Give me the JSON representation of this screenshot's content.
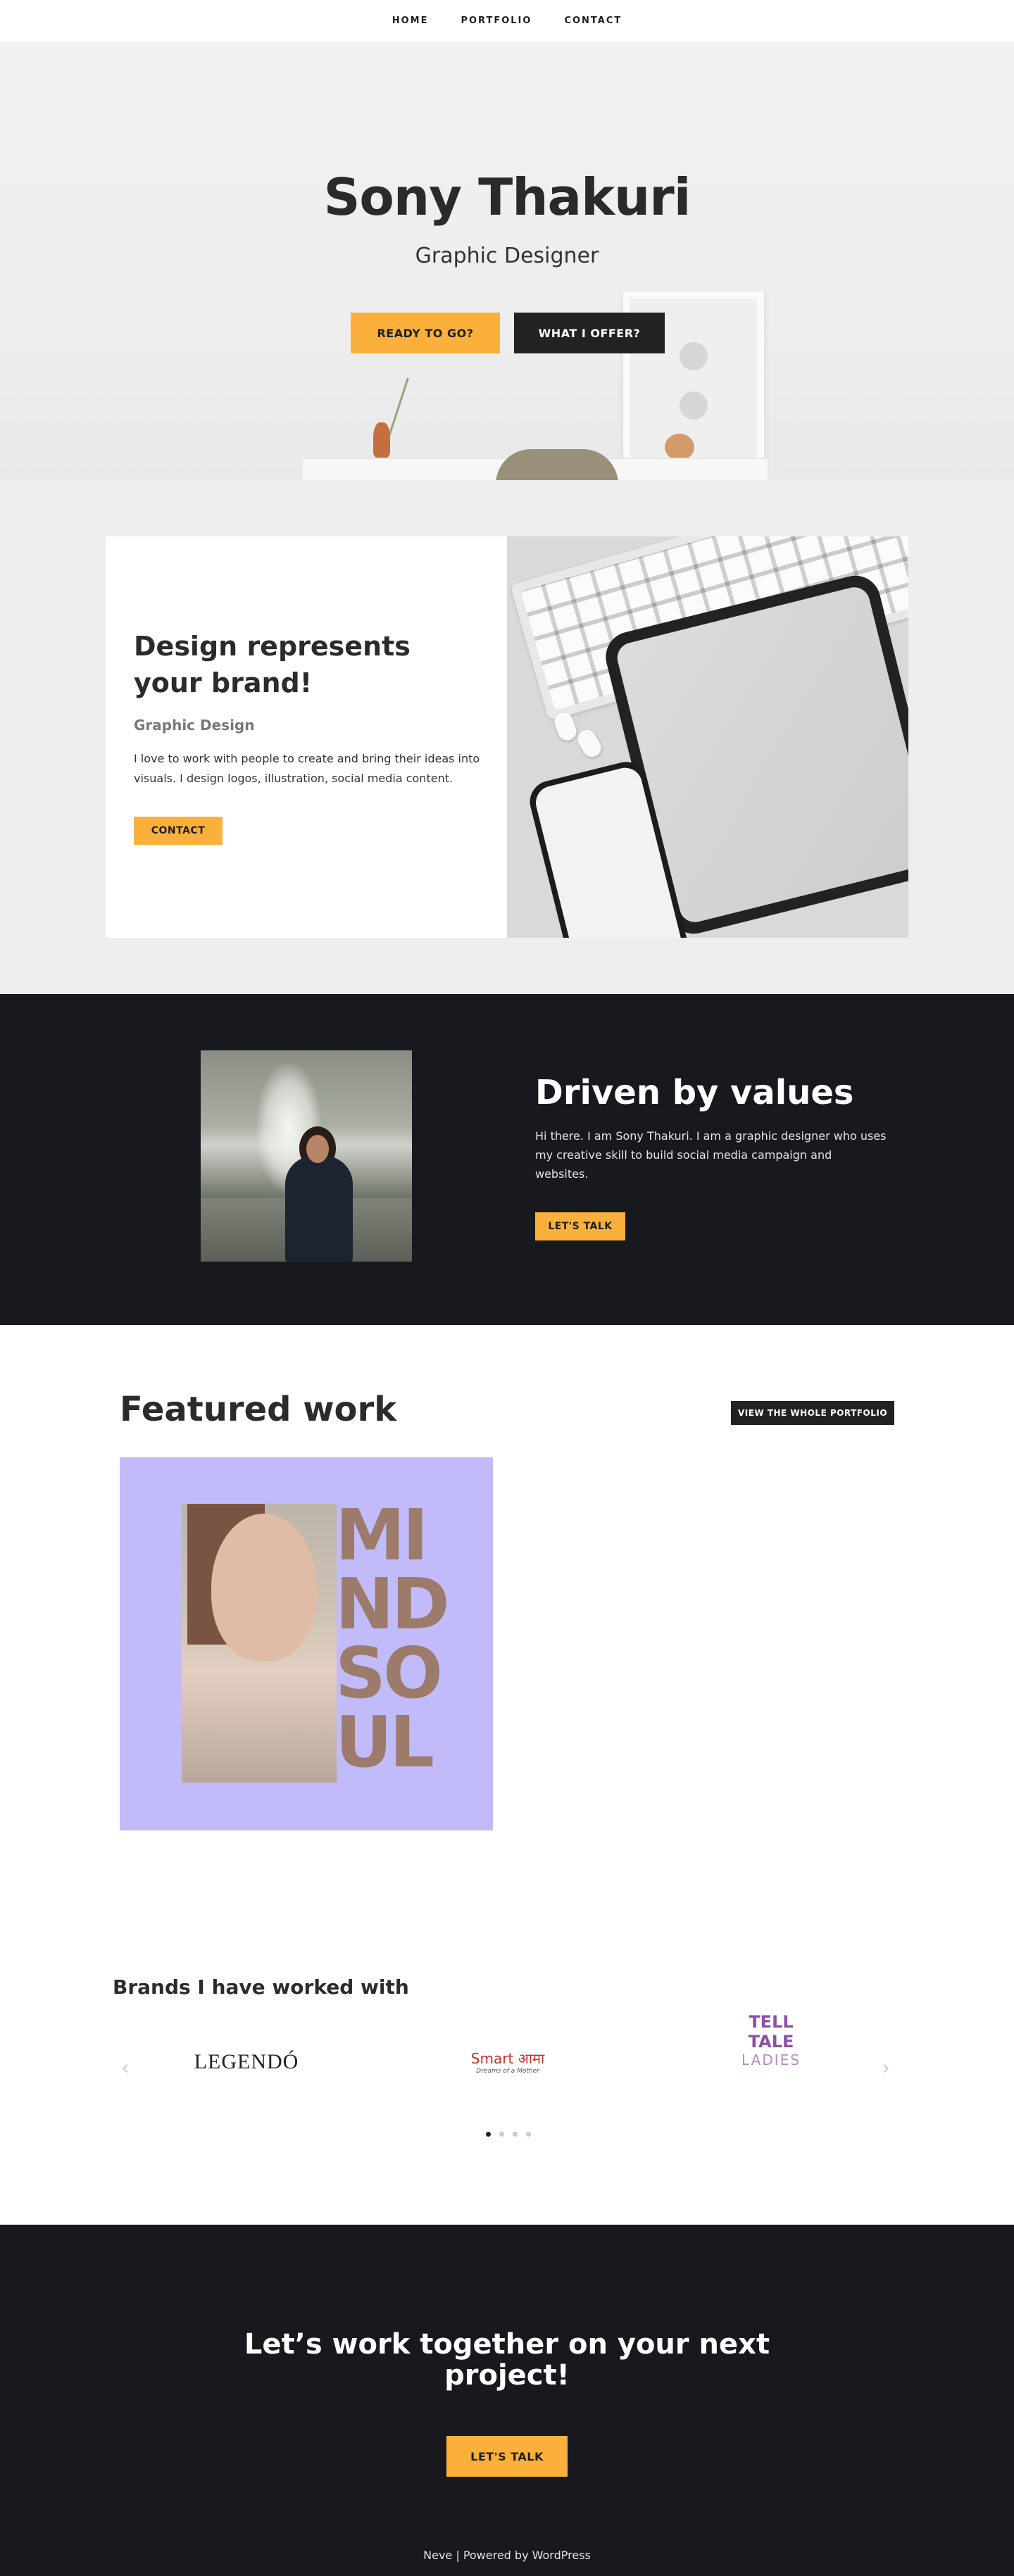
{
  "nav": {
    "items": [
      "HOME",
      "PORTFOLIO",
      "CONTACT"
    ]
  },
  "hero": {
    "title": "Sony Thakuri",
    "subtitle": "Graphic Designer",
    "btn_primary": "READY TO GO?",
    "btn_secondary": "WHAT I OFFER?"
  },
  "intro": {
    "heading": "Design represents your brand!",
    "subheading": "Graphic Design",
    "description": "I love to work with people to create and bring their ideas into visuals. I design logos, illustration, social media content.",
    "button": "CONTACT"
  },
  "about": {
    "heading": "Driven by values",
    "description": "Hi there. I am Sony Thakuri. I am a graphic designer who uses my creative skill to build  social media campaign and websites.",
    "button": "LET'S TALK"
  },
  "featured": {
    "heading": "Featured work",
    "button": "VIEW THE WHOLE PORTFOLIO",
    "artwork_letters": [
      "MI",
      "ND",
      "SO",
      "UL"
    ]
  },
  "brands": {
    "heading": "Brands I have worked with",
    "prev_arrow": "‹",
    "next_arrow": "›",
    "brand1": "LEGENDÓ",
    "brand2_title": "Smart आमा",
    "brand2_tagline": "Dreams of a Mother",
    "brand3_line1": "TELL TALE",
    "brand3_line2": "LADIES"
  },
  "cta": {
    "heading": "Let’s work together on your next project!",
    "button": "LET'S TALK"
  },
  "footer": {
    "text": "Neve | Powered by WordPress"
  },
  "colors": {
    "accent": "#fbb03b",
    "dark": "#18191e",
    "button_dark": "#222222",
    "section_bg": "#eeefec",
    "work_bg": "#c1bbfa"
  }
}
